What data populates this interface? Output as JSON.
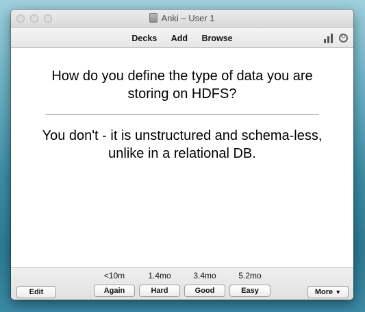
{
  "window": {
    "title": "Anki – User 1"
  },
  "toolbar": {
    "decks": "Decks",
    "add": "Add",
    "browse": "Browse"
  },
  "card": {
    "question": "How do you define the type of data you are storing on HDFS?",
    "answer": "You don't - it is unstructured and schema-less, unlike in a relational DB."
  },
  "bottom": {
    "edit": "Edit",
    "more": "More",
    "answers": [
      {
        "interval": "<10m",
        "label": "Again"
      },
      {
        "interval": "1.4mo",
        "label": "Hard"
      },
      {
        "interval": "3.4mo",
        "label": "Good"
      },
      {
        "interval": "5.2mo",
        "label": "Easy"
      }
    ]
  },
  "icons": [
    "stats-icon",
    "sync-icon",
    "app-icon",
    "dropdown-arrow-icon"
  ]
}
